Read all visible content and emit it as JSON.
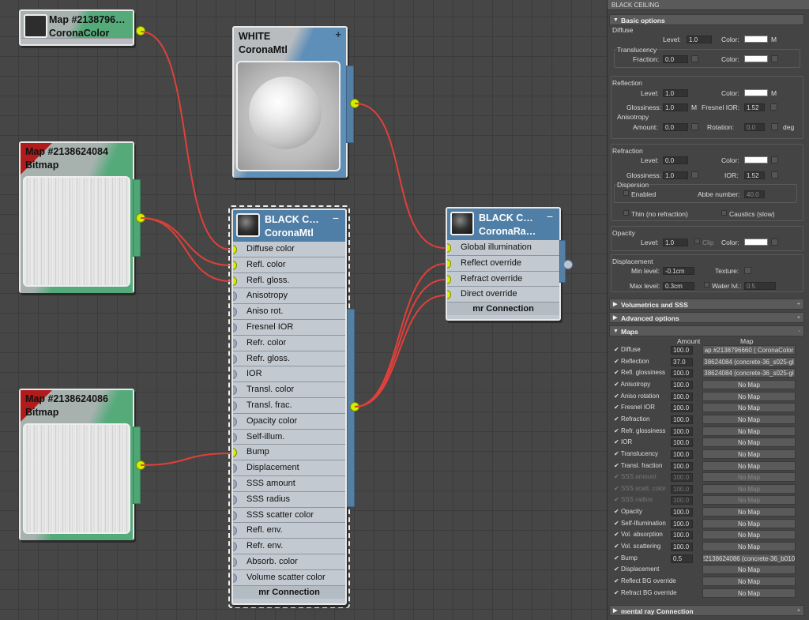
{
  "nodes": {
    "corona_color": {
      "title": "Map  #2138796…",
      "subtitle": "CoronaColor"
    },
    "white_mtl": {
      "title": "WHITE",
      "subtitle": "CoronaMtl",
      "plus": "+"
    },
    "bitmap1": {
      "title": "Map #2138624084",
      "subtitle": "Bitmap"
    },
    "bitmap2": {
      "title": "Map #2138624086",
      "subtitle": "Bitmap"
    },
    "black_mtl": {
      "title": "BLACK  C…",
      "subtitle": "CoronaMtl",
      "minus": "−",
      "footer": "mr Connection",
      "slots": [
        "Diffuse color",
        "Refl. color",
        "Refl. gloss.",
        "Anisotropy",
        "Aniso rot.",
        "Fresnel IOR",
        "Refr. color",
        "Refr. gloss.",
        "IOR",
        "Transl. color",
        "Transl. frac.",
        "Opacity color",
        "Self-illum.",
        "Bump",
        "Displacement",
        "SSS amount",
        "SSS radius",
        "SSS scatter color",
        "Refl. env.",
        "Refr. env.",
        "Absorb. color",
        "Volume scatter color"
      ]
    },
    "black_ray": {
      "title": "BLACK  C…",
      "subtitle": "CoronaRa…",
      "minus": "−",
      "footer": "mr Connection",
      "slots": [
        "Global illumination",
        "Reflect override",
        "Refract override",
        "Direct override"
      ]
    }
  },
  "panel": {
    "title": "BLACK CEILING",
    "basic_options": "Basic options",
    "diffuse": {
      "header": "Diffuse",
      "level_label": "Level:",
      "level": "1.0",
      "color_label": "Color:",
      "m": "M",
      "translucency": "Translucency",
      "fraction_label": "Fraction:",
      "fraction": "0.0",
      "color2_label": "Color:"
    },
    "reflection": {
      "header": "Reflection",
      "level_label": "Level:",
      "level": "1.0",
      "color_label": "Color:",
      "m": "M",
      "gloss_label": "Glossiness:",
      "gloss": "1.0",
      "gm": "M",
      "fresnel_label": "Fresnel IOR:",
      "fresnel": "1.52",
      "anisotropy": "Anisotropy",
      "amount_label": "Amount:",
      "amount": "0.0",
      "rotation_label": "Rotation:",
      "rotation": "0.0",
      "deg": "deg"
    },
    "refraction": {
      "header": "Refraction",
      "level_label": "Level:",
      "level": "0.0",
      "color_label": "Color:",
      "gloss_label": "Glossiness:",
      "gloss": "1.0",
      "ior_label": "IOR:",
      "ior": "1.52",
      "dispersion": "Dispersion",
      "enabled": "Enabled",
      "abbe_label": "Abbe number:",
      "abbe": "40.0",
      "thin": "Thin (no refraction)",
      "caustics": "Caustics (slow)"
    },
    "opacity": {
      "header": "Opacity",
      "level_label": "Level:",
      "level": "1.0",
      "clip": "Clip",
      "color_label": "Color:"
    },
    "displacement": {
      "header": "Displacement",
      "min_label": "Min level:",
      "min": "-0.1cm",
      "texture_label": "Texture:",
      "max_label": "Max level:",
      "max": "0.3cm",
      "water_label": "Water lvl.:",
      "water": "0.5"
    },
    "volumetrics": "Volumetrics and SSS",
    "advanced": "Advanced options",
    "maps": {
      "header": "Maps",
      "amount_col": "Amount",
      "map_col": "Map",
      "rows": [
        {
          "label": "Diffuse",
          "amount": "100.0",
          "map": "ap #2138796660  ( CoronaColor"
        },
        {
          "label": "Reflection",
          "amount": "37.0",
          "map": "38624084 (concrete-36_s025-gl"
        },
        {
          "label": "Refl. glossiness",
          "amount": "100.0",
          "map": "38624084 (concrete-36_s025-gl"
        },
        {
          "label": "Anisotropy",
          "amount": "100.0",
          "map": "No Map"
        },
        {
          "label": "Aniso rotation",
          "amount": "100.0",
          "map": "No Map"
        },
        {
          "label": "Fresnel IOR",
          "amount": "100.0",
          "map": "No Map"
        },
        {
          "label": "Refraction",
          "amount": "100.0",
          "map": "No Map"
        },
        {
          "label": "Refr. glossiness",
          "amount": "100.0",
          "map": "No Map"
        },
        {
          "label": "IOR",
          "amount": "100.0",
          "map": "No Map"
        },
        {
          "label": "Translucency",
          "amount": "100.0",
          "map": "No Map"
        },
        {
          "label": "Transl. fraction",
          "amount": "100.0",
          "map": "No Map"
        },
        {
          "label": "SSS amount",
          "amount": "100.0",
          "map": "No Map"
        },
        {
          "label": "SSS scatt. color",
          "amount": "100.0",
          "map": "No Map"
        },
        {
          "label": "SSS radius",
          "amount": "100.0",
          "map": "No Map"
        },
        {
          "label": "Opacity",
          "amount": "100.0",
          "map": "No Map"
        },
        {
          "label": "Self-Illumination",
          "amount": "100.0",
          "map": "No Map"
        },
        {
          "label": "Vol. absorption",
          "amount": "100.0",
          "map": "No Map"
        },
        {
          "label": "Vol. scattering",
          "amount": "100.0",
          "map": "No Map"
        },
        {
          "label": "Bump",
          "amount": "0.5",
          "map": "!2138624086 (concrete-36_b010"
        },
        {
          "label": "Displacement",
          "amount": "",
          "map": "No Map"
        },
        {
          "label": "Reflect BG override",
          "amount": "",
          "map": "No Map"
        },
        {
          "label": "Refract BG override",
          "amount": "",
          "map": "No Map"
        }
      ]
    },
    "mental_ray": "mental ray Connection"
  },
  "colors": {
    "wire": "#e0403a",
    "socket_active": "#d4f000",
    "header_green": "#55aa7a",
    "header_blue": "#5e8fb9"
  }
}
